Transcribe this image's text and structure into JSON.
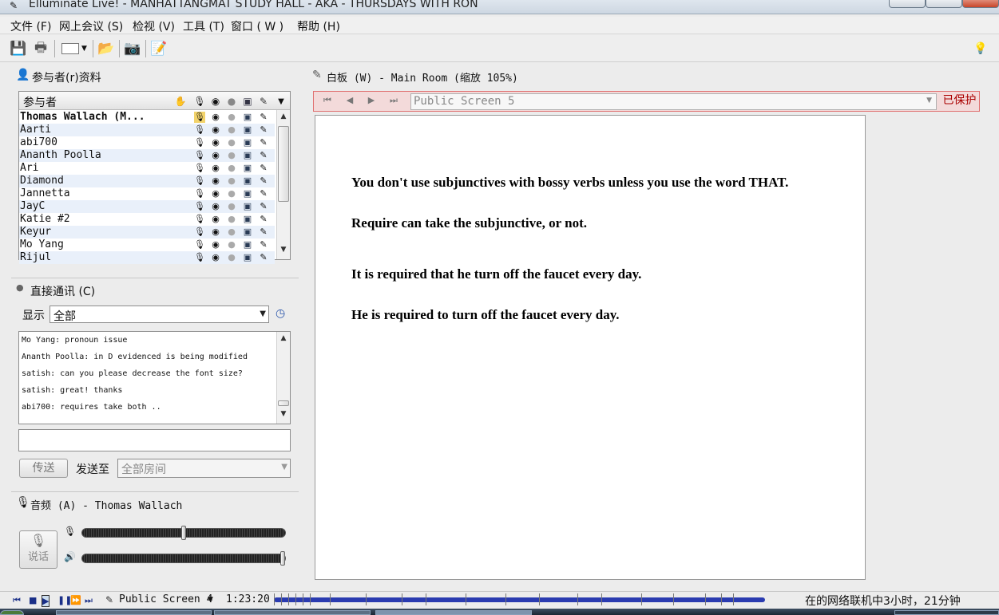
{
  "window": {
    "title": "Elluminate Live! - MANHATTANGMAT STUDY HALL - AKA - THURSDAYS WITH RON"
  },
  "menu": {
    "items": [
      "文件 (F)",
      "网上会议 (S)",
      "检视 (V)",
      "工具 (T)",
      "窗口 ( W )",
      "帮助 (H)"
    ]
  },
  "participants": {
    "panel_title": "参与者(r)资料",
    "column_header": "参与者",
    "rows": [
      "Thomas Wallach (M...",
      "Aarti",
      "abi700",
      "Ananth Poolla",
      "Ari",
      "Diamond",
      "Jannetta",
      "JayC",
      "Katie #2",
      "Keyur",
      "Mo Yang",
      "Rijul"
    ]
  },
  "chat": {
    "panel_title": "直接通讯 (C)",
    "show_label": "显示",
    "show_value": "全部",
    "messages": [
      "Mo Yang: pronoun issue",
      "Ananth Poolla: in D evidenced is being modified",
      "satish: can you please decrease the font size?",
      "satish: great! thanks",
      "abi700: requires take both .."
    ],
    "input_value": "",
    "send_label": "传送",
    "send_to_label": "发送至",
    "send_to_value": "全部房间"
  },
  "audio": {
    "panel_title": "音频 (A) - Thomas Wallach",
    "talk_label": "说话",
    "mic_level": 0.5,
    "speaker_level": 1.0
  },
  "whiteboard": {
    "panel_title": "白板 (W) - Main Room (缩放 105%)",
    "screen_value": "Public Screen 5",
    "protected_label": "已保护",
    "lines": [
      "You don't use subjunctives with bossy verbs unless you use the word THAT.",
      "Require can take the subjunctive, or not.",
      "It is required that he turn off the faucet every day.",
      "He is required to turn off the faucet every day."
    ]
  },
  "playback": {
    "screen_value": "Public Screen 4",
    "time": "1:23:20",
    "status": "在的网络联机中3小时，21分钟"
  },
  "colors": {
    "timeline": "#2a3bb0",
    "protected_bg": "#f3dada",
    "protected_border": "#e07070",
    "row_alt": "#e9f0fa"
  }
}
